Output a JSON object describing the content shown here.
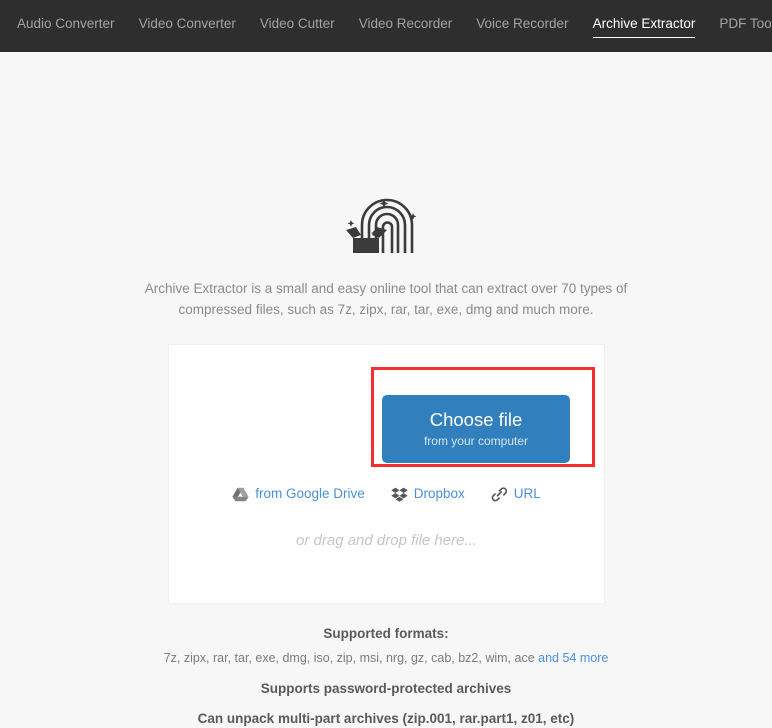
{
  "nav": {
    "items": [
      {
        "label": "Audio Converter",
        "active": false
      },
      {
        "label": "Video Converter",
        "active": false
      },
      {
        "label": "Video Cutter",
        "active": false
      },
      {
        "label": "Video Recorder",
        "active": false
      },
      {
        "label": "Voice Recorder",
        "active": false
      },
      {
        "label": "Archive Extractor",
        "active": true
      },
      {
        "label": "PDF Tools",
        "active": false
      }
    ]
  },
  "hero": {
    "icon": "archive-rainbow-box-icon",
    "description": "Archive Extractor is a small and easy online tool that can extract over 70 types of compressed files, such as 7z, zipx, rar, tar, exe, dmg and much more."
  },
  "upload": {
    "choose_file_label": "Choose file",
    "choose_file_sub": "from your computer",
    "highlight_color": "#f42f2f",
    "button_color": "#3180bd",
    "services": [
      {
        "label": "from Google Drive",
        "icon": "google-drive-icon"
      },
      {
        "label": "Dropbox",
        "icon": "dropbox-icon"
      },
      {
        "label": "URL",
        "icon": "link-icon"
      }
    ],
    "drag_drop_text": "or drag and drop file here..."
  },
  "info": {
    "supported_formats_title": "Supported formats:",
    "formats_list": "7z, zipx, rar, tar, exe, dmg, iso, zip, msi, nrg, gz, cab, bz2, wim, ace",
    "more_link": "and 54 more",
    "password_line": "Supports password-protected archives",
    "multipart_line": "Can unpack multi-part archives (zip.001, rar.part1, z01, etc)"
  }
}
